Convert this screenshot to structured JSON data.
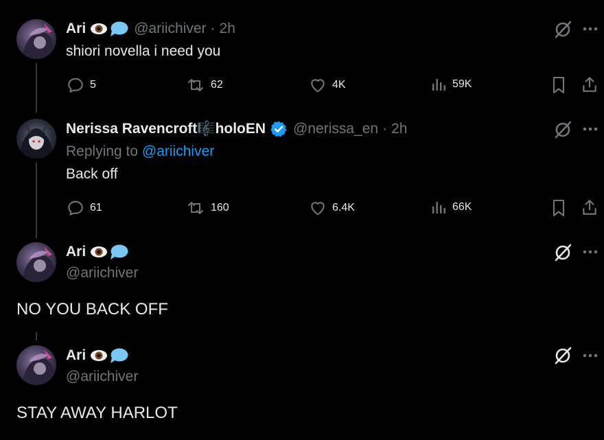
{
  "colors": {
    "background": "#000000",
    "text": "#e7e9ea",
    "muted": "#71767b",
    "accent": "#1d9bf0",
    "thread_line": "#333639"
  },
  "posts": [
    {
      "display_name": "Ari",
      "emoji": [
        "eye-icon",
        "speech-bubble-icon"
      ],
      "handle": "@ariichiver",
      "separator": "·",
      "time": "2h",
      "text": "shiori novella i need you",
      "stats": {
        "replies": "5",
        "reposts": "62",
        "likes": "4K",
        "views": "59K"
      }
    },
    {
      "display_name": "Nerissa Ravencroft🎼holoEN",
      "verified": true,
      "handle": "@nerissa_en",
      "separator": "·",
      "time": "2h",
      "replying_prefix": "Replying to",
      "replying_to": "@ariichiver",
      "text": "Back off",
      "stats": {
        "replies": "61",
        "reposts": "160",
        "likes": "6.4K",
        "views": "66K"
      }
    },
    {
      "display_name": "Ari",
      "emoji": [
        "eye-icon",
        "speech-bubble-icon"
      ],
      "handle": "@ariichiver",
      "text": "NO YOU BACK OFF"
    },
    {
      "display_name": "Ari",
      "emoji": [
        "eye-icon",
        "speech-bubble-icon"
      ],
      "handle": "@ariichiver",
      "text": "STAY AWAY HARLOT"
    }
  ]
}
